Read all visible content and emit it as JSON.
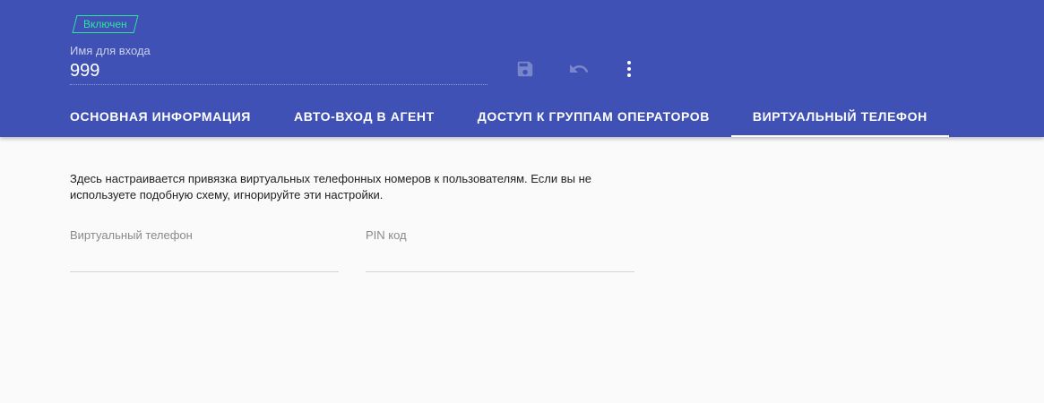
{
  "header": {
    "status_badge": "Включен",
    "login_label": "Имя для входа",
    "login_value": "999",
    "icons": [
      "save-icon",
      "undo-icon",
      "more-vert-icon"
    ]
  },
  "tabs": [
    {
      "label": "ОСНОВНАЯ ИНФОРМАЦИЯ",
      "active": false
    },
    {
      "label": "АВТО-ВХОД В АГЕНТ",
      "active": false
    },
    {
      "label": "ДОСТУП К ГРУППАМ ОПЕРАТОРОВ",
      "active": false
    },
    {
      "label": "ВИРТУАЛЬНЫЙ ТЕЛЕФОН",
      "active": true
    }
  ],
  "content": {
    "description": "Здесь настраивается привязка виртуальных телефонных номеров к пользователям. Если вы не используете подобную схему, игнорируйте эти настройки.",
    "fields": {
      "virtual_phone": {
        "label": "Виртуальный телефон",
        "value": ""
      },
      "pin": {
        "label": "PIN код",
        "value": ""
      }
    }
  },
  "colors": {
    "header_bg": "#3f51b5",
    "badge": "#2ee59d",
    "page_bg": "#fafafa"
  }
}
